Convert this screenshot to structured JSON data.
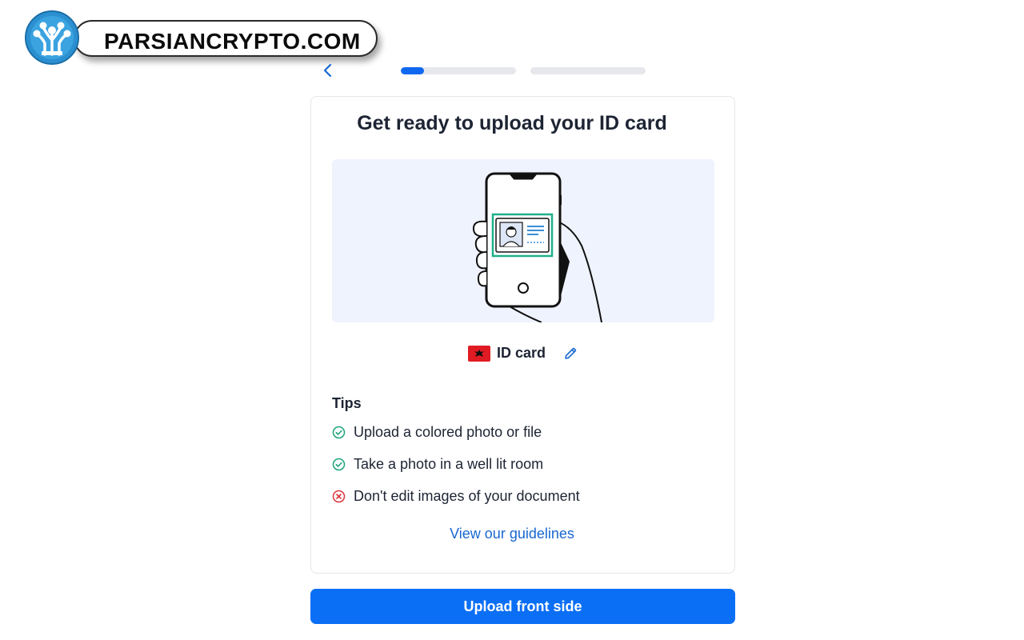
{
  "watermark": {
    "text": "PARSIANCRYPTO.COM"
  },
  "progress": {
    "steps": [
      {
        "fraction": 0.2
      },
      {
        "fraction": 0.0
      }
    ]
  },
  "card": {
    "title": "Get ready to upload your ID card",
    "document": {
      "label": "ID card",
      "flag_color": "#e11b23"
    },
    "tips": {
      "title": "Tips",
      "items": [
        {
          "text": "Upload a colored photo or file",
          "status": "ok",
          "icon": "check-circle-icon"
        },
        {
          "text": "Take a photo in a well lit room",
          "status": "ok",
          "icon": "check-circle-icon"
        },
        {
          "text": "Don't edit images of your document",
          "status": "error",
          "icon": "x-circle-icon"
        }
      ]
    },
    "guidelines_link": "View our guidelines"
  },
  "upload_button": "Upload front side",
  "colors": {
    "primary": "#0b6ff5",
    "link": "#1868d0",
    "success": "#1aa57a",
    "error": "#d9363e",
    "illustration_bg": "#eff3fd",
    "id_frame": "#1fb08a"
  }
}
